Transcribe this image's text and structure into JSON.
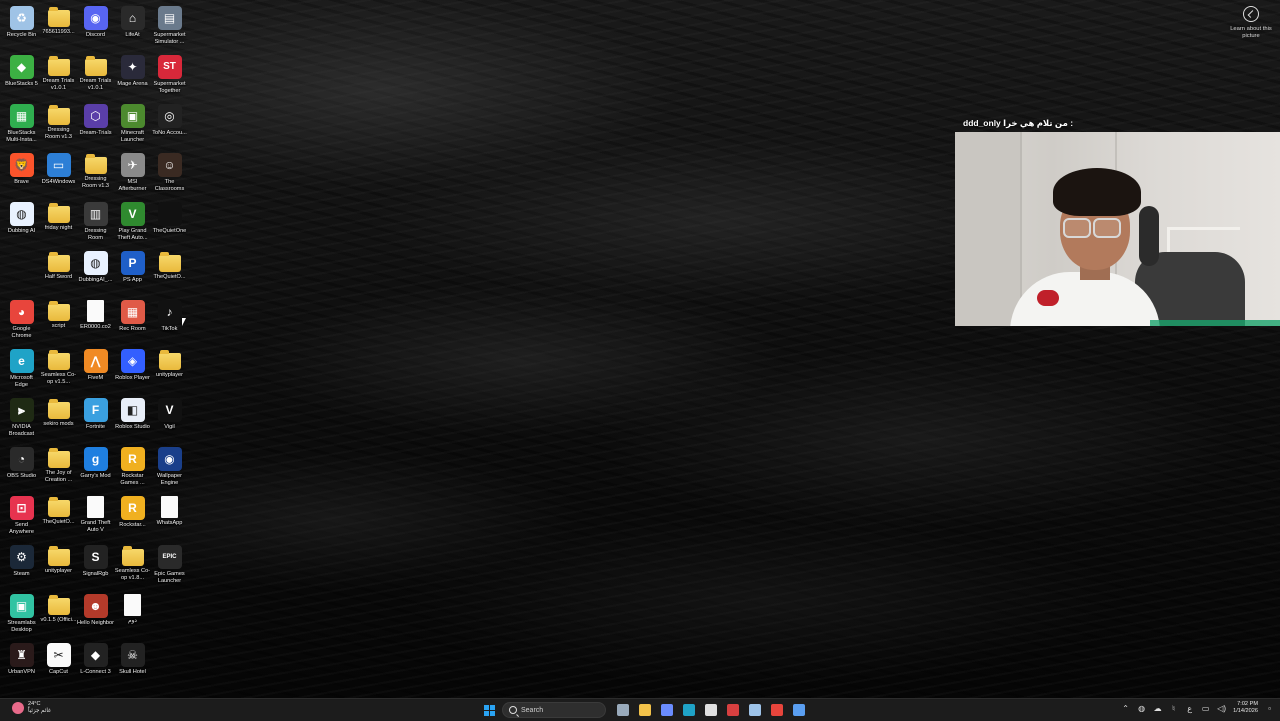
{
  "desktop": {
    "icons": [
      {
        "label": "Recycle Bin",
        "icon": "recycle-bin-icon",
        "kind": "app",
        "color": "#9fc3e6",
        "glyph": "♻"
      },
      {
        "label": "765611993...",
        "icon": "folder-icon",
        "kind": "folder"
      },
      {
        "label": "Discord",
        "icon": "discord-icon",
        "kind": "app",
        "color": "#5865f2",
        "glyph": "◉"
      },
      {
        "label": "LifeAt",
        "icon": "lifeat-icon",
        "kind": "app",
        "color": "#2a2a2a",
        "glyph": "⌂"
      },
      {
        "label": "Supermarket Simulator ...",
        "icon": "supermarket-simulator-icon",
        "kind": "app",
        "color": "#6a7a8c",
        "glyph": "▤"
      },
      {
        "label": "BlueStacks 5",
        "icon": "bluestacks-icon",
        "kind": "app",
        "color": "#3cb043",
        "glyph": "◆"
      },
      {
        "label": "Dream Trials v1.0.1",
        "icon": "folder-icon",
        "kind": "folder"
      },
      {
        "label": "Dream Trials v1.0.1",
        "icon": "folder-icon",
        "kind": "folder"
      },
      {
        "label": "Mage Arena",
        "icon": "mage-arena-icon",
        "kind": "app",
        "color": "#2a2a3a",
        "glyph": "✦"
      },
      {
        "label": "Supermarket Together",
        "icon": "supermarket-together-icon",
        "kind": "app",
        "color": "#d8283a",
        "glyph": "ST"
      },
      {
        "label": "BlueStacks Multi-Insta...",
        "icon": "bluestacks-multi-icon",
        "kind": "app",
        "color": "#2fae4f",
        "glyph": "▦"
      },
      {
        "label": "Dressing Room v1.3",
        "icon": "folder-image-icon",
        "kind": "folder"
      },
      {
        "label": "Dream-Trials",
        "icon": "dream-trials-icon",
        "kind": "app",
        "color": "#5a3ea8",
        "glyph": "⬡"
      },
      {
        "label": "Minecraft Launcher",
        "icon": "minecraft-icon",
        "kind": "app",
        "color": "#4c8a2e",
        "glyph": "▣"
      },
      {
        "label": "ToNo Accou...",
        "icon": "tono-icon",
        "kind": "app",
        "color": "#222",
        "glyph": "◎"
      },
      {
        "label": "Brave",
        "icon": "brave-icon",
        "kind": "app",
        "color": "#fb542b",
        "glyph": "🦁"
      },
      {
        "label": "DS4Windows",
        "icon": "ds4windows-icon",
        "kind": "app",
        "color": "#2d7fd6",
        "glyph": "▭"
      },
      {
        "label": "Dressing Room v1.3",
        "icon": "folder-icon",
        "kind": "folder"
      },
      {
        "label": "MSI Afterburner",
        "icon": "msi-afterburner-icon",
        "kind": "app",
        "color": "#8a8a8a",
        "glyph": "✈"
      },
      {
        "label": "The Classrooms",
        "icon": "the-classrooms-icon",
        "kind": "app",
        "color": "#3a2a22",
        "glyph": "☺"
      },
      {
        "label": "Dubbing AI",
        "icon": "dubbing-ai-icon",
        "kind": "app",
        "color": "#e9f2ff",
        "glyph": "◍"
      },
      {
        "label": "friday night",
        "icon": "folder-icon",
        "kind": "folder"
      },
      {
        "label": "Dressing Room",
        "icon": "dressing-room-icon",
        "kind": "app",
        "color": "#3a3a3a",
        "glyph": "▥"
      },
      {
        "label": "Play Grand Theft Auto...",
        "icon": "gta-play-icon",
        "kind": "app",
        "color": "#2f8a2f",
        "glyph": "V"
      },
      {
        "label": "TheQuietOne",
        "icon": "thequietone-icon",
        "kind": "app",
        "color": "#111",
        "glyph": ""
      },
      {
        "label": "",
        "icon": "",
        "kind": "empty"
      },
      {
        "label": "Half Sword",
        "icon": "half-sword-icon",
        "kind": "folder"
      },
      {
        "label": "DubbingAI_...",
        "icon": "dubbing-ai-installer-icon",
        "kind": "app",
        "color": "#e9f2ff",
        "glyph": "◍"
      },
      {
        "label": "PS App",
        "icon": "playstation-icon",
        "kind": "app",
        "color": "#1f5fc8",
        "glyph": "P"
      },
      {
        "label": "TheQuietO...",
        "icon": "folder-icon",
        "kind": "folder"
      },
      {
        "label": "Google Chrome",
        "icon": "chrome-icon",
        "kind": "app",
        "color": "#e8453c",
        "glyph": "◕"
      },
      {
        "label": "script",
        "icon": "folder-icon",
        "kind": "folder"
      },
      {
        "label": "ER0000.co2",
        "icon": "file-icon",
        "kind": "doc"
      },
      {
        "label": "Rec Room",
        "icon": "rec-room-icon",
        "kind": "app",
        "color": "#e05a47",
        "glyph": "▦"
      },
      {
        "label": "TikTok",
        "icon": "tiktok-icon",
        "kind": "app",
        "color": "#111",
        "glyph": "♪"
      },
      {
        "label": "Microsoft Edge",
        "icon": "edge-icon",
        "kind": "app",
        "color": "#1fa3c7",
        "glyph": "e"
      },
      {
        "label": "Seamless Co-op v1.5...",
        "icon": "folder-icon",
        "kind": "folder"
      },
      {
        "label": "FiveM",
        "icon": "fivem-icon",
        "kind": "app",
        "color": "#f08a24",
        "glyph": "⋀"
      },
      {
        "label": "Roblox Player",
        "icon": "roblox-icon",
        "kind": "app",
        "color": "#335fff",
        "glyph": "◈"
      },
      {
        "label": "unityplayer",
        "icon": "folder-icon",
        "kind": "folder"
      },
      {
        "label": "NVIDIA Broadcast",
        "icon": "nvidia-broadcast-icon",
        "kind": "app",
        "color": "#1f2a14",
        "glyph": "⫸"
      },
      {
        "label": "sekiro mods",
        "icon": "folder-image-icon",
        "kind": "folder"
      },
      {
        "label": "Fortnite",
        "icon": "fortnite-icon",
        "kind": "app",
        "color": "#3aa0e0",
        "glyph": "F"
      },
      {
        "label": "Roblox Studio",
        "icon": "roblox-studio-icon",
        "kind": "app",
        "color": "#e8eef8",
        "glyph": "◧"
      },
      {
        "label": "Vigil",
        "icon": "vigil-icon",
        "kind": "app",
        "color": "#111",
        "glyph": "V"
      },
      {
        "label": "OBS Studio",
        "icon": "obs-icon",
        "kind": "app",
        "color": "#2a2a2a",
        "glyph": "◔"
      },
      {
        "label": "The Joy of Creation ...",
        "icon": "folder-icon",
        "kind": "folder"
      },
      {
        "label": "Garry's Mod",
        "icon": "garrys-mod-icon",
        "kind": "app",
        "color": "#1f7fe0",
        "glyph": "g"
      },
      {
        "label": "Rockstar Games ...",
        "icon": "rockstar-icon",
        "kind": "app",
        "color": "#f0b020",
        "glyph": "R"
      },
      {
        "label": "Wallpaper Engine",
        "icon": "wallpaper-engine-icon",
        "kind": "app",
        "color": "#1a3f8a",
        "glyph": "◉"
      },
      {
        "label": "Send Anywhere",
        "icon": "send-anywhere-icon",
        "kind": "app",
        "color": "#e7334f",
        "glyph": "⊡"
      },
      {
        "label": "TheQuietO...",
        "icon": "folder-image-icon",
        "kind": "folder"
      },
      {
        "label": "Grand Theft Auto V",
        "icon": "file-icon",
        "kind": "doc"
      },
      {
        "label": "Rockstar...",
        "icon": "rockstar-launcher-icon",
        "kind": "app",
        "color": "#f0b020",
        "glyph": "R"
      },
      {
        "label": "WhatsApp",
        "icon": "file-icon",
        "kind": "doc"
      },
      {
        "label": "Steam",
        "icon": "steam-icon",
        "kind": "app",
        "color": "#1b2838",
        "glyph": "⚙"
      },
      {
        "label": "unityplayer",
        "icon": "folder-icon",
        "kind": "folder"
      },
      {
        "label": "SignalRgb",
        "icon": "signalrgb-icon",
        "kind": "app",
        "color": "#222",
        "glyph": "S"
      },
      {
        "label": "Seamless Co-op v1.8...",
        "icon": "folder-icon",
        "kind": "folder"
      },
      {
        "label": "Epic Games Launcher",
        "icon": "epic-games-icon",
        "kind": "app",
        "color": "#2a2a2a",
        "glyph": "EPIC"
      },
      {
        "label": "Streamlabs Desktop",
        "icon": "streamlabs-icon",
        "kind": "app",
        "color": "#31c3a2",
        "glyph": "▣"
      },
      {
        "label": "v0.1.5 (Offici...",
        "icon": "folder-icon",
        "kind": "folder"
      },
      {
        "label": "Hello Neighbor",
        "icon": "hello-neighbor-icon",
        "kind": "app",
        "color": "#b43a2a",
        "glyph": "☻"
      },
      {
        "label": "دوم",
        "icon": "text-file-icon",
        "kind": "doc"
      },
      {
        "label": "",
        "icon": "",
        "kind": "empty"
      },
      {
        "label": "UrbanVPN",
        "icon": "urbanvpn-icon",
        "kind": "app",
        "color": "#2a1a1a",
        "glyph": "♜"
      },
      {
        "label": "CapCut",
        "icon": "capcut-icon",
        "kind": "app",
        "color": "#fafafa",
        "glyph": "✂"
      },
      {
        "label": "L-Connect 3",
        "icon": "lconnect-icon",
        "kind": "app",
        "color": "#222",
        "glyph": "◆"
      },
      {
        "label": "Skull Hotel",
        "icon": "skull-hotel-icon",
        "kind": "app",
        "color": "#222",
        "glyph": "☠"
      },
      {
        "label": "",
        "icon": "",
        "kind": "empty"
      }
    ]
  },
  "learn_about": {
    "label": "Learn about this picture",
    "icon": "camera-icon"
  },
  "overlay": {
    "chat_user": "ddd_only",
    "chat_text": "من تلام هي خرا :"
  },
  "taskbar": {
    "weather_temp": "24°C",
    "weather_desc": "غائم جزئياً",
    "search_placeholder": "Search",
    "time": "7:02 PM",
    "date": "1/14/2026",
    "tray_lang": "ع",
    "pinned": [
      {
        "name": "task-view-button",
        "color": "#9ab"
      },
      {
        "name": "file-explorer-button",
        "color": "#f2c24a"
      },
      {
        "name": "copilot-button",
        "color": "#6a8cff"
      },
      {
        "name": "edge-taskbar-button",
        "color": "#1fa3c7"
      },
      {
        "name": "store-button",
        "color": "#e0e0e0"
      },
      {
        "name": "app-red-button",
        "color": "#d84040"
      },
      {
        "name": "steam-taskbar-button",
        "color": "#9ec3e8"
      },
      {
        "name": "chrome-taskbar-button",
        "color": "#e8453c"
      },
      {
        "name": "discord-taskbar-button",
        "color": "#5a9ef0"
      }
    ]
  }
}
